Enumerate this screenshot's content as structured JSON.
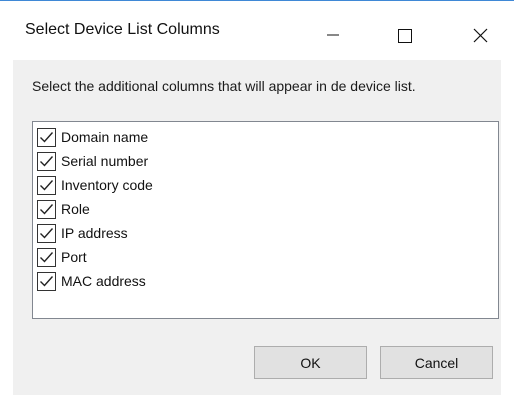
{
  "window": {
    "title": "Select Device List Columns",
    "accent_color": "#3f88d6"
  },
  "titlebar_buttons": {
    "minimize_icon": "minimize-icon",
    "maximize_icon": "maximize-icon",
    "close_icon": "close-icon"
  },
  "dialog": {
    "instruction": "Select the additional columns that will appear in de device list.",
    "columns": [
      {
        "label": "Domain name",
        "checked": true
      },
      {
        "label": "Serial number",
        "checked": true
      },
      {
        "label": "Inventory code",
        "checked": true
      },
      {
        "label": "Role",
        "checked": true
      },
      {
        "label": "IP address",
        "checked": true
      },
      {
        "label": "Port",
        "checked": true
      },
      {
        "label": "MAC address",
        "checked": true
      }
    ],
    "ok_label": "OK",
    "cancel_label": "Cancel"
  }
}
